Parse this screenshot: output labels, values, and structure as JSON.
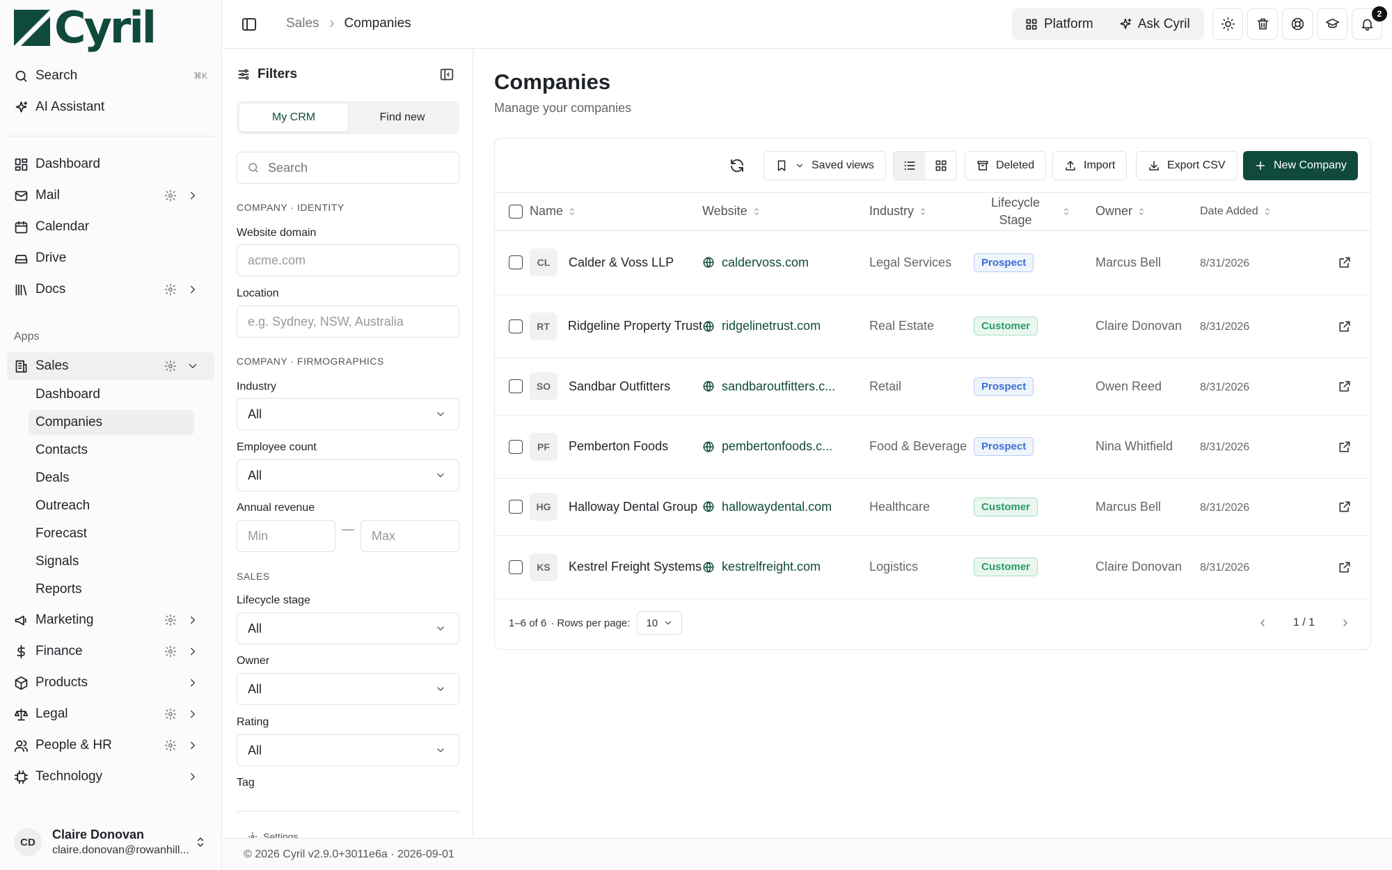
{
  "brand": {
    "name": "Cyril",
    "color": "#0f4a3c"
  },
  "sidebar": {
    "search": {
      "label": "Search",
      "shortcut": "⌘K"
    },
    "ai_assistant": "AI Assistant",
    "nav": [
      {
        "label": "Dashboard",
        "icon": "dashboard-icon"
      },
      {
        "label": "Mail",
        "icon": "mail-icon"
      },
      {
        "label": "Calendar",
        "icon": "calendar-icon"
      },
      {
        "label": "Drive",
        "icon": "drive-icon"
      },
      {
        "label": "Docs",
        "icon": "docs-icon"
      }
    ],
    "apps_label": "Apps",
    "sales": {
      "label": "Sales",
      "children": [
        "Dashboard",
        "Companies",
        "Contacts",
        "Deals",
        "Outreach",
        "Forecast",
        "Signals",
        "Reports"
      ],
      "active_child": "Companies"
    },
    "apps": [
      {
        "label": "Marketing",
        "icon": "megaphone-icon"
      },
      {
        "label": "Finance",
        "icon": "dollar-icon"
      },
      {
        "label": "Products",
        "icon": "box-icon"
      },
      {
        "label": "Legal",
        "icon": "scale-icon"
      },
      {
        "label": "People & HR",
        "icon": "people-icon"
      },
      {
        "label": "Technology",
        "icon": "chip-icon"
      }
    ],
    "user": {
      "initials": "CD",
      "name": "Claire Donovan",
      "email": "claire.donovan@rowanhill..."
    }
  },
  "header": {
    "breadcrumb": [
      "Sales",
      "Companies"
    ],
    "platform_label": "Platform",
    "ask_label": "Ask Cyril",
    "notification_count": "2"
  },
  "filters": {
    "title": "Filters",
    "tabs": [
      "My CRM",
      "Find new"
    ],
    "active_tab": "My CRM",
    "search_placeholder": "Search",
    "section_identity": "COMPANY · IDENTITY",
    "website_label": "Website domain",
    "website_placeholder": "acme.com",
    "location_label": "Location",
    "location_placeholder": "e.g. Sydney, NSW, Australia",
    "section_firmographics": "COMPANY · FIRMOGRAPHICS",
    "industry_label": "Industry",
    "industry_value": "All",
    "employee_label": "Employee count",
    "employee_value": "All",
    "revenue_label": "Annual revenue",
    "revenue_min_placeholder": "Min",
    "revenue_max_placeholder": "Max",
    "revenue_dash": "—",
    "section_sales": "SALES",
    "lifecycle_label": "Lifecycle stage",
    "lifecycle_value": "All",
    "owner_label": "Owner",
    "owner_value": "All",
    "rating_label": "Rating",
    "rating_value": "All",
    "tag_label": "Tag",
    "settings_peek": "Settings"
  },
  "main": {
    "title": "Companies",
    "subtitle": "Manage your companies",
    "toolbar": {
      "saved_views": "Saved views",
      "deleted": "Deleted",
      "import": "Import",
      "export": "Export CSV",
      "new_company": "New Company"
    },
    "columns": [
      "Name",
      "Website",
      "Industry",
      "Lifecycle Stage",
      "Owner",
      "Date Added"
    ],
    "rows": [
      {
        "initials": "CL",
        "name": "Calder & Voss LLP",
        "website": "caldervoss.com",
        "industry": "Legal Services",
        "stage": "Prospect",
        "owner": "Marcus Bell",
        "date": "8/31/2026"
      },
      {
        "initials": "RT",
        "name": "Ridgeline Property Trust",
        "website": "ridgelinetrust.com",
        "industry": "Real Estate",
        "stage": "Customer",
        "owner": "Claire Donovan",
        "date": "8/31/2026"
      },
      {
        "initials": "SO",
        "name": "Sandbar Outfitters",
        "website": "sandbaroutfitters.c...",
        "industry": "Retail",
        "stage": "Prospect",
        "owner": "Owen Reed",
        "date": "8/31/2026"
      },
      {
        "initials": "PF",
        "name": "Pemberton Foods",
        "website": "pembertonfoods.c...",
        "industry": "Food & Beverage",
        "stage": "Prospect",
        "owner": "Nina Whitfield",
        "date": "8/31/2026"
      },
      {
        "initials": "HG",
        "name": "Halloway Dental Group",
        "website": "hallowaydental.com",
        "industry": "Healthcare",
        "stage": "Customer",
        "owner": "Marcus Bell",
        "date": "8/31/2026"
      },
      {
        "initials": "KS",
        "name": "Kestrel Freight Systems",
        "website": "kestrelfreight.com",
        "industry": "Logistics",
        "stage": "Customer",
        "owner": "Claire Donovan",
        "date": "8/31/2026"
      }
    ],
    "pagination": {
      "range": "1–6 of 6",
      "rows_per_page_label": "· Rows per page:",
      "rows_per_page": "10",
      "page": "1 / 1"
    }
  },
  "footer": {
    "text": "© 2026 Cyril v2.9.0+3011e6a · 2026-09-01"
  },
  "colors": {
    "accent": "#0f4a3c",
    "prospect": "#3b6fd4",
    "customer": "#2a9a66"
  }
}
